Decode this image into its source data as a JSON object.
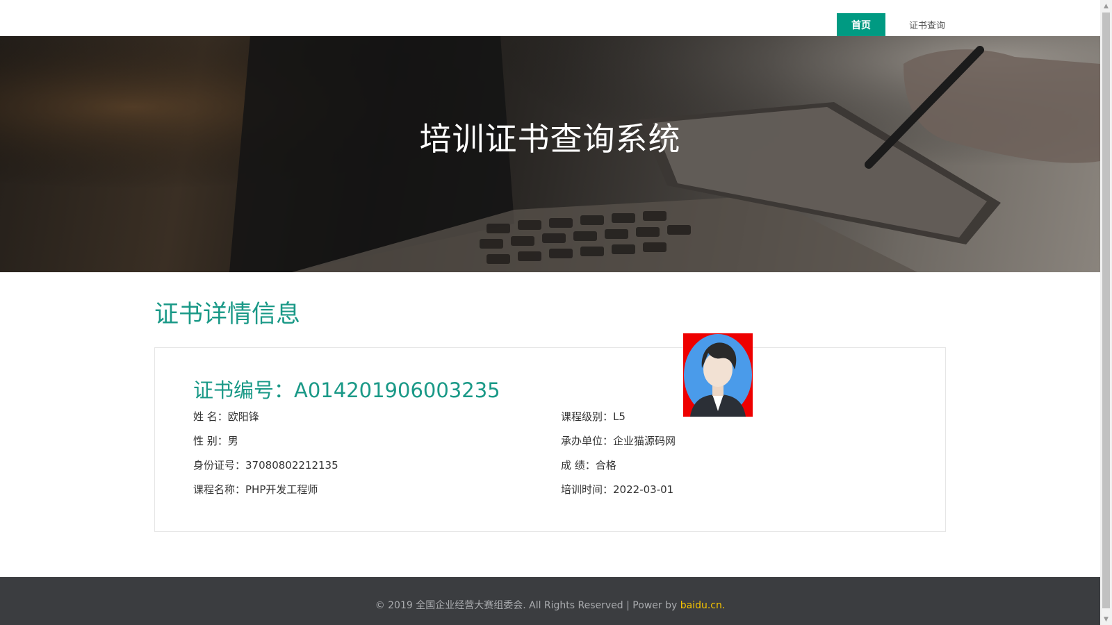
{
  "nav": {
    "home": "首页",
    "cert_query": "证书查询"
  },
  "hero": {
    "title": "培训证书查询系统"
  },
  "section": {
    "title": "证书详情信息"
  },
  "certificate": {
    "number_label": "证书编号：",
    "number": "A014201906003235",
    "left_fields": [
      {
        "label": "姓 名：",
        "value": "欧阳锋"
      },
      {
        "label": "性 别：",
        "value": "男"
      },
      {
        "label": "身份证号：",
        "value": "37080802212135"
      },
      {
        "label": "课程名称：",
        "value": "PHP开发工程师"
      }
    ],
    "right_fields": [
      {
        "label": "课程级别：",
        "value": "L5"
      },
      {
        "label": "承办单位：",
        "value": "企业猫源码网"
      },
      {
        "label": "成 绩：",
        "value": "合格"
      },
      {
        "label": "培训时间：",
        "value": "2022-03-01"
      }
    ]
  },
  "footer": {
    "text": "© 2019 全国企业经营大赛组委会. All Rights Reserved | Power by ",
    "link": "baidu.cn."
  },
  "colors": {
    "accent": "#009a82",
    "heading": "#1a9987",
    "footer_bg": "#3b3d40",
    "footer_link": "#f5c400",
    "avatar_bg": "#ee0000"
  }
}
